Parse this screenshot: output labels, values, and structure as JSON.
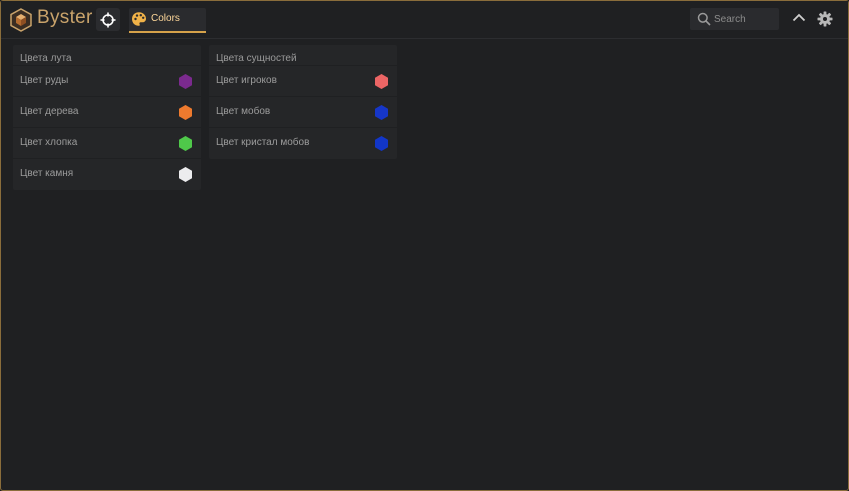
{
  "app": {
    "brand": "Byster"
  },
  "tabs": [
    {
      "label": "Colors",
      "active": true
    }
  ],
  "search": {
    "placeholder": "Search",
    "value": ""
  },
  "panels": [
    {
      "title": "Цвета лута",
      "items": [
        {
          "label": "Цвет руды",
          "color": "#7b2a8e"
        },
        {
          "label": "Цвет дерева",
          "color": "#ee7a2e"
        },
        {
          "label": "Цвет хлопка",
          "color": "#4fc84a"
        },
        {
          "label": "Цвет камня",
          "color": "#ececee"
        }
      ]
    },
    {
      "title": "Цвета сущностей",
      "items": [
        {
          "label": "Цвет игроков",
          "color": "#ec6565"
        },
        {
          "label": "Цвет мобов",
          "color": "#1636c8"
        },
        {
          "label": "Цвет кристал мобов",
          "color": "#1236c8"
        }
      ]
    }
  ],
  "theme": {
    "accent": "#d6a24a",
    "brand_color": "#c9a36b"
  },
  "icons": {
    "logo": "hexagon-logo-icon",
    "crosshair": "crosshair-icon",
    "palette": "palette-icon",
    "search": "search-icon",
    "collapse": "chevron-up-icon",
    "settings": "gear-icon"
  }
}
